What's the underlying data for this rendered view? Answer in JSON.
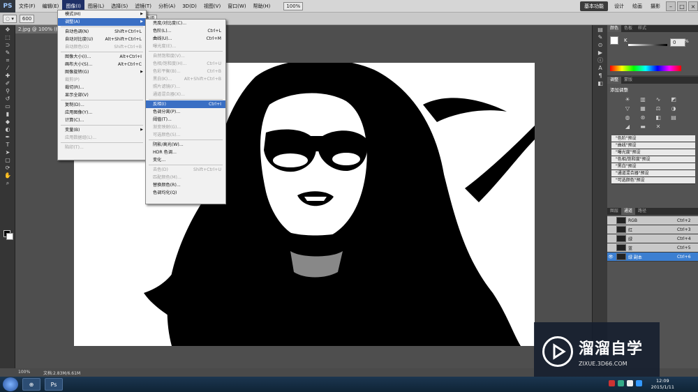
{
  "app": {
    "logo": "PS"
  },
  "menubar": {
    "items": [
      "文件(F)",
      "编辑(E)",
      "图像(I)",
      "图层(L)",
      "选择(S)",
      "滤镜(T)",
      "分析(A)",
      "3D(D)",
      "视图(V)",
      "窗口(W)",
      "帮助(H)"
    ],
    "active_index": 2,
    "zoom": "100%",
    "workspaces": [
      "基本功能",
      "设计",
      "绘画",
      "摄影"
    ],
    "active_workspace": "基本功能",
    "window_controls": [
      "–",
      "□",
      "×"
    ]
  },
  "options": {
    "brush_size": "600",
    "protect_tone": "保护色调"
  },
  "document": {
    "tab_title": "2.jpg @ 100% (绿副本/8)",
    "zoom_status": "100%",
    "doc_size": "文档:2.83M/6.61M"
  },
  "image_menu": {
    "items": [
      {
        "label": "模式(M)",
        "key": "",
        "sub": true,
        "disabled": false
      },
      {
        "label": "调整(A)",
        "key": "",
        "sub": true,
        "disabled": false,
        "highlight": true
      },
      {
        "sep": true
      },
      {
        "label": "自动色调(N)",
        "key": "Shift+Ctrl+L",
        "disabled": false
      },
      {
        "label": "自动对比度(U)",
        "key": "Alt+Shift+Ctrl+L",
        "disabled": false
      },
      {
        "label": "自动颜色(O)",
        "key": "Shift+Ctrl+B",
        "disabled": true
      },
      {
        "sep": true
      },
      {
        "label": "图像大小(I)...",
        "key": "Alt+Ctrl+I",
        "disabled": false
      },
      {
        "label": "画布大小(S)...",
        "key": "Alt+Ctrl+C",
        "disabled": false
      },
      {
        "label": "图像旋转(G)",
        "key": "",
        "sub": true,
        "disabled": false
      },
      {
        "label": "裁剪(P)",
        "key": "",
        "disabled": true
      },
      {
        "label": "裁切(R)...",
        "key": "",
        "disabled": false
      },
      {
        "label": "显示全部(V)",
        "key": "",
        "disabled": false
      },
      {
        "sep": true
      },
      {
        "label": "复制(D)...",
        "key": "",
        "disabled": false
      },
      {
        "label": "应用图像(Y)...",
        "key": "",
        "disabled": false
      },
      {
        "label": "计算(C)...",
        "key": "",
        "disabled": false
      },
      {
        "sep": true
      },
      {
        "label": "变量(B)",
        "key": "",
        "sub": true,
        "disabled": false
      },
      {
        "label": "应用数据组(L)...",
        "key": "",
        "disabled": true
      },
      {
        "sep": true
      },
      {
        "label": "陷印(T)...",
        "key": "",
        "disabled": true
      }
    ]
  },
  "adjust_submenu": {
    "items": [
      {
        "label": "亮度/对比度(C)...",
        "key": "",
        "disabled": false
      },
      {
        "label": "色阶(L)...",
        "key": "Ctrl+L",
        "disabled": false
      },
      {
        "label": "曲线(U)...",
        "key": "Ctrl+M",
        "disabled": false
      },
      {
        "label": "曝光度(E)...",
        "key": "",
        "disabled": true
      },
      {
        "sep": true
      },
      {
        "label": "自然饱和度(V)...",
        "key": "",
        "disabled": true
      },
      {
        "label": "色相/饱和度(H)...",
        "key": "Ctrl+U",
        "disabled": true
      },
      {
        "label": "色彩平衡(B)...",
        "key": "Ctrl+B",
        "disabled": true
      },
      {
        "label": "黑白(K)...",
        "key": "Alt+Shift+Ctrl+B",
        "disabled": true
      },
      {
        "label": "照片滤镜(F)...",
        "key": "",
        "disabled": true
      },
      {
        "label": "通道混合器(X)...",
        "key": "",
        "disabled": true
      },
      {
        "sep": true
      },
      {
        "label": "反相(I)",
        "key": "Ctrl+I",
        "disabled": false,
        "highlight": true
      },
      {
        "label": "色调分离(P)...",
        "key": "",
        "disabled": false
      },
      {
        "label": "阈值(T)...",
        "key": "",
        "disabled": false
      },
      {
        "label": "渐变映射(G)...",
        "key": "",
        "disabled": true
      },
      {
        "label": "可选颜色(S)...",
        "key": "",
        "disabled": true
      },
      {
        "sep": true
      },
      {
        "label": "阴影/高光(W)...",
        "key": "",
        "disabled": false
      },
      {
        "label": "HDR 色调...",
        "key": "",
        "disabled": false
      },
      {
        "label": "变化...",
        "key": "",
        "disabled": false
      },
      {
        "sep": true
      },
      {
        "label": "去色(D)",
        "key": "Shift+Ctrl+U",
        "disabled": true
      },
      {
        "label": "匹配颜色(M)...",
        "key": "",
        "disabled": true
      },
      {
        "label": "替换颜色(R)...",
        "key": "",
        "disabled": false
      },
      {
        "label": "色调均化(Q)",
        "key": "",
        "disabled": false
      }
    ]
  },
  "panels": {
    "color_tabs": [
      "颜色",
      "色板",
      "样式"
    ],
    "color_channel": "K",
    "color_value": "0",
    "color_unit": "%",
    "adjust_tabs": [
      "调整",
      "蒙版"
    ],
    "adjust_title": "添加调整",
    "presets": [
      "\"色阶\"预设",
      "\"曲线\"预设",
      "\"曝光度\"预设",
      "\"色相/饱和度\"预设",
      "\"黑白\"预设",
      "\"通道混合器\"预设",
      "\"可选颜色\"预设"
    ],
    "layer_tabs": [
      "图层",
      "通道",
      "路径"
    ],
    "channels": [
      {
        "name": "RGB",
        "key": "Ctrl+2",
        "selected": false
      },
      {
        "name": "红",
        "key": "Ctrl+3",
        "selected": false
      },
      {
        "name": "绿",
        "key": "Ctrl+4",
        "selected": false
      },
      {
        "name": "蓝",
        "key": "Ctrl+5",
        "selected": false
      },
      {
        "name": "绿 副本",
        "key": "Ctrl+6",
        "selected": true
      }
    ]
  },
  "taskbar": {
    "ps_label": "Ps",
    "time": "12:09",
    "date": "2015/1/11"
  },
  "watermark": {
    "title": "溜溜自学",
    "url": "ZIXUE.3D66.COM"
  }
}
